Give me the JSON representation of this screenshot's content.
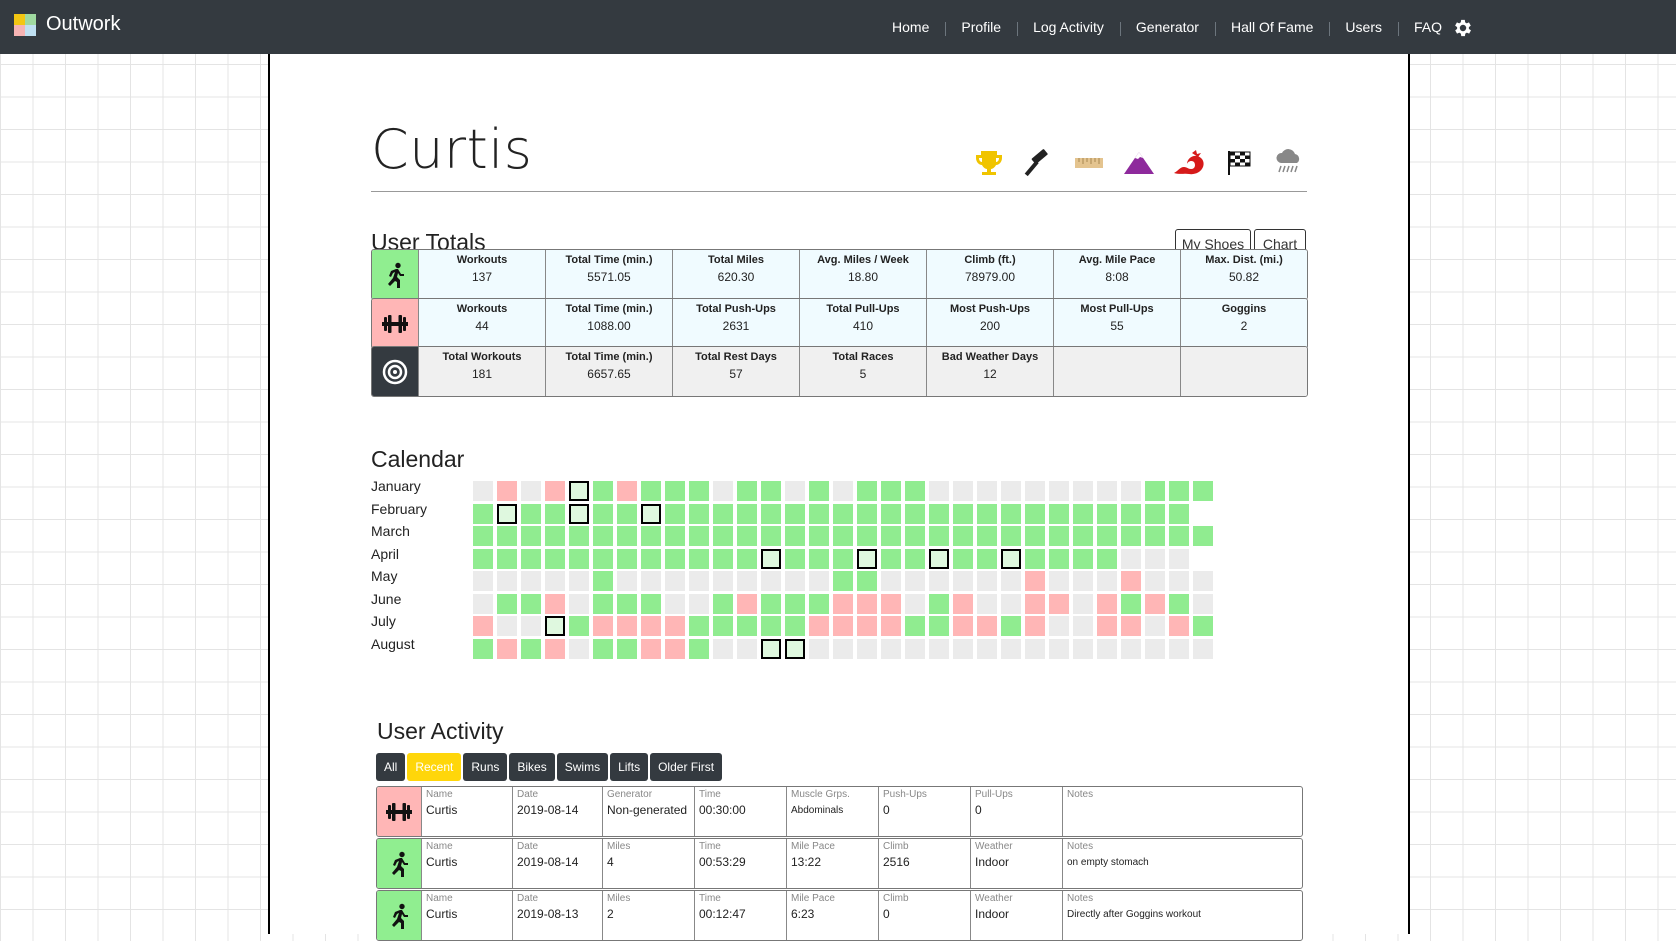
{
  "app": {
    "name": "Outwork"
  },
  "nav": [
    "Home",
    "Profile",
    "Log Activity",
    "Generator",
    "Hall Of Fame",
    "Users",
    "FAQ"
  ],
  "profile": {
    "name": "Curtis",
    "badges": [
      "trophy-icon",
      "hammer-icon",
      "ruler-icon",
      "mountain-icon",
      "dragon-icon",
      "checkered-flag-icon",
      "rain-cloud-icon"
    ]
  },
  "totals": {
    "title": "User Totals",
    "buttons": {
      "shoes": "My Shoes",
      "chart": "Chart"
    },
    "rows": [
      {
        "icon": "runner-icon",
        "color": "#90ee90",
        "bg": "#f0fbff",
        "cells": [
          {
            "label": "Workouts",
            "value": "137"
          },
          {
            "label": "Total Time (min.)",
            "value": "5571.05"
          },
          {
            "label": "Total Miles",
            "value": "620.30"
          },
          {
            "label": "Avg. Miles / Week",
            "value": "18.80"
          },
          {
            "label": "Climb (ft.)",
            "value": "78979.00"
          },
          {
            "label": "Avg. Mile Pace",
            "value": "8:08"
          },
          {
            "label": "Max. Dist. (mi.)",
            "value": "50.82"
          }
        ]
      },
      {
        "icon": "dumbbell-icon",
        "color": "#ffb6b6",
        "bg": "#f0fbff",
        "cells": [
          {
            "label": "Workouts",
            "value": "44"
          },
          {
            "label": "Total Time (min.)",
            "value": "1088.00"
          },
          {
            "label": "Total Push-Ups",
            "value": "2631"
          },
          {
            "label": "Total Pull-Ups",
            "value": "410"
          },
          {
            "label": "Most Push-Ups",
            "value": "200"
          },
          {
            "label": "Most Pull-Ups",
            "value": "55"
          },
          {
            "label": "Goggins",
            "value": "2"
          }
        ]
      },
      {
        "icon": "target-icon",
        "color": "#343a40",
        "bg": "#f0f0f0",
        "cells": [
          {
            "label": "Total Workouts",
            "value": "181"
          },
          {
            "label": "Total Time (min.)",
            "value": "6657.65"
          },
          {
            "label": "Total Rest Days",
            "value": "57"
          },
          {
            "label": "Total Races",
            "value": "5"
          },
          {
            "label": "Bad Weather Days",
            "value": "12"
          },
          {
            "label": "",
            "value": ""
          },
          {
            "label": "",
            "value": ""
          }
        ]
      }
    ]
  },
  "calendar": {
    "title": "Calendar",
    "legend": {
      "e": "#ebebeb",
      "g": "#90ec90",
      "r": "#ffb6b6",
      "b": "boxed"
    },
    "months": [
      {
        "name": "January",
        "days": "ererbgrgggeggegeggge eeeeeeeegggg"
      },
      {
        "name": "February",
        "days": "gbggbggbgggggggggggggggggggggg"
      },
      {
        "name": "March",
        "days": "ggggggggggggggggggggggggggggggg"
      },
      {
        "name": "April",
        "days": "ggggggggggggbgggbggbggbggggeee"
      },
      {
        "name": "May",
        "days": "eeeeegeeeeeeeeeggeeeeeereeereee"
      },
      {
        "name": "June",
        "days": "eggregggeegrgggrrregreerrergrgegg"
      },
      {
        "name": "July",
        "days": "reebgrrrrgggggrrrrggrrgreerrerggrg"
      },
      {
        "name": "August",
        "days": "grgreggrrgeebbeeeeeeeeeeeeeeeeeee"
      }
    ]
  },
  "activity": {
    "title": "User Activity",
    "filters": [
      "All",
      "Recent",
      "Runs",
      "Bikes",
      "Swims",
      "Lifts",
      "Older First"
    ],
    "active_filter": "Recent",
    "rows": [
      {
        "icon": "dumbbell-icon",
        "color": "#ffb6b6",
        "cells": [
          {
            "label": "Name",
            "value": "Curtis"
          },
          {
            "label": "Date",
            "value": "2019-08-14"
          },
          {
            "label": "Generator",
            "value": "Non-generated"
          },
          {
            "label": "Time",
            "value": "00:30:00"
          },
          {
            "label": "Muscle Grps.",
            "value": "Abdominals",
            "small": true
          },
          {
            "label": "Push-Ups",
            "value": "0"
          },
          {
            "label": "Pull-Ups",
            "value": "0"
          },
          {
            "label": "Notes",
            "value": ""
          }
        ]
      },
      {
        "icon": "runner-icon",
        "color": "#90ee90",
        "cells": [
          {
            "label": "Name",
            "value": "Curtis"
          },
          {
            "label": "Date",
            "value": "2019-08-14"
          },
          {
            "label": "Miles",
            "value": "4"
          },
          {
            "label": "Time",
            "value": "00:53:29"
          },
          {
            "label": "Mile Pace",
            "value": "13:22"
          },
          {
            "label": "Climb",
            "value": "2516"
          },
          {
            "label": "Weather",
            "value": "Indoor"
          },
          {
            "label": "Notes",
            "value": "on empty stomach",
            "small": true
          }
        ]
      },
      {
        "icon": "runner-icon",
        "color": "#90ee90",
        "cells": [
          {
            "label": "Name",
            "value": "Curtis"
          },
          {
            "label": "Date",
            "value": "2019-08-13"
          },
          {
            "label": "Miles",
            "value": "2"
          },
          {
            "label": "Time",
            "value": "00:12:47"
          },
          {
            "label": "Mile Pace",
            "value": "6:23"
          },
          {
            "label": "Climb",
            "value": "0"
          },
          {
            "label": "Weather",
            "value": "Indoor"
          },
          {
            "label": "Notes",
            "value": "Directly after Goggins workout",
            "small": true
          }
        ]
      }
    ]
  }
}
